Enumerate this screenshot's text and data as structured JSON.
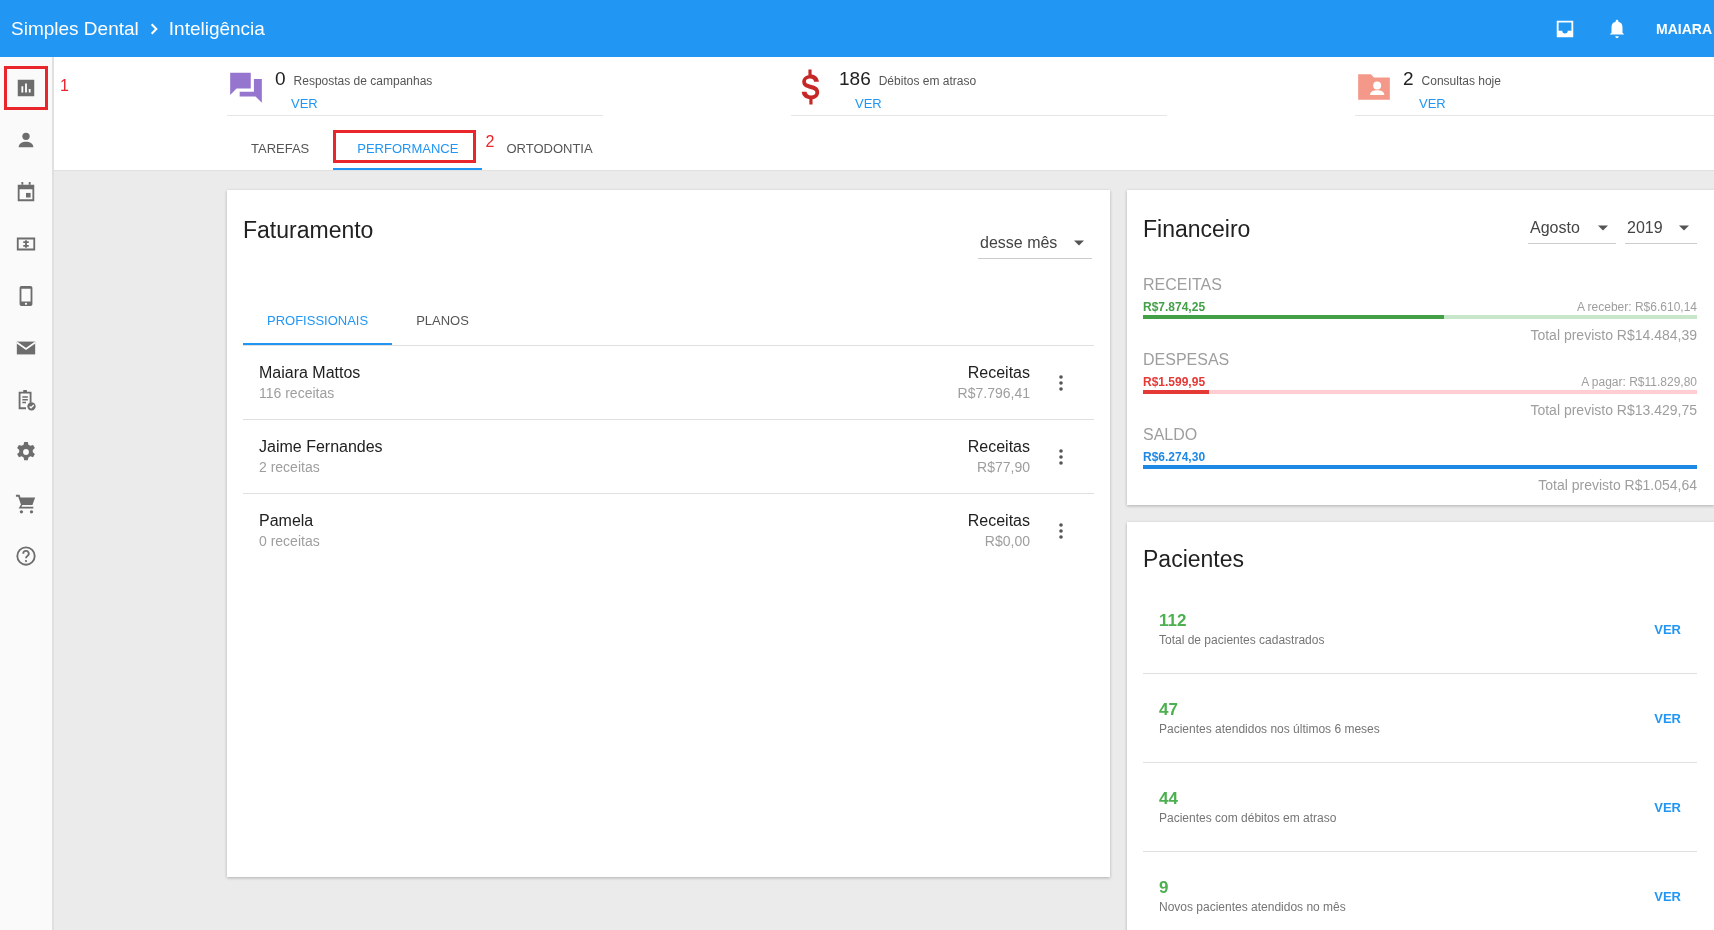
{
  "topbar": {
    "breadcrumb": [
      "Simples Dental",
      "Inteligência"
    ],
    "user": "MAIARA"
  },
  "sidebar": {
    "items": [
      {
        "kind": "chart",
        "annotation": "1"
      },
      {
        "kind": "person"
      },
      {
        "kind": "calendar"
      },
      {
        "kind": "money"
      },
      {
        "kind": "phone"
      },
      {
        "kind": "mail"
      },
      {
        "kind": "clipboard"
      },
      {
        "kind": "gear"
      },
      {
        "kind": "cart"
      },
      {
        "kind": "help"
      }
    ]
  },
  "stats": [
    {
      "kind": "chat",
      "count": "0",
      "label": "Respostas de campanhas",
      "link": "VER"
    },
    {
      "kind": "dollar",
      "count": "186",
      "label": "Débitos em atraso",
      "link": "VER"
    },
    {
      "kind": "folder",
      "count": "2",
      "label": "Consultas hoje",
      "link": "VER"
    }
  ],
  "tabs": [
    {
      "label": "TAREFAS",
      "selected": false
    },
    {
      "label": "PERFORMANCE",
      "selected": true,
      "annotation": "2"
    },
    {
      "label": "ORTODONTIA",
      "selected": false
    }
  ],
  "faturamento": {
    "title": "Faturamento",
    "period": "desse mês",
    "tabs": [
      {
        "label": "PROFISSIONAIS",
        "selected": true
      },
      {
        "label": "PLANOS",
        "selected": false
      }
    ],
    "rows": [
      {
        "name": "Maiara Mattos",
        "count": "116 receitas",
        "metric": "Receitas",
        "value": "R$7.796,41"
      },
      {
        "name": "Jaime Fernandes",
        "count": "2 receitas",
        "metric": "Receitas",
        "value": "R$77,90"
      },
      {
        "name": "Pamela",
        "count": "0 receitas",
        "metric": "Receitas",
        "value": "R$0,00"
      }
    ]
  },
  "financeiro": {
    "title": "Financeiro",
    "month": "Agosto",
    "year": "2019",
    "sections": [
      {
        "kind": "income",
        "label": "RECEITAS",
        "amount": "R$7.874,25",
        "level": 0.544,
        "pending": "A receber: R$6.610,14",
        "total": "Total previsto R$14.484,39"
      },
      {
        "kind": "expense",
        "label": "DESPESAS",
        "amount": "R$1.599,95",
        "level": 0.12,
        "pending": "A pagar: R$11.829,80",
        "total": "Total previsto R$13.429,75"
      },
      {
        "kind": "balance",
        "label": "SALDO",
        "amount": "R$6.274,30",
        "level": 1,
        "total": "Total previsto R$1.054,64"
      }
    ]
  },
  "pacientes": {
    "title": "Pacientes",
    "items": [
      {
        "value": "112",
        "label": "Total de pacientes cadastrados",
        "link": "VER"
      },
      {
        "value": "47",
        "label": "Pacientes atendidos nos últimos 6 meses",
        "link": "VER"
      },
      {
        "value": "44",
        "label": "Pacientes com débitos em atraso",
        "link": "VER"
      },
      {
        "value": "9",
        "label": "Novos pacientes atendidos no mês",
        "link": "VER"
      }
    ]
  }
}
